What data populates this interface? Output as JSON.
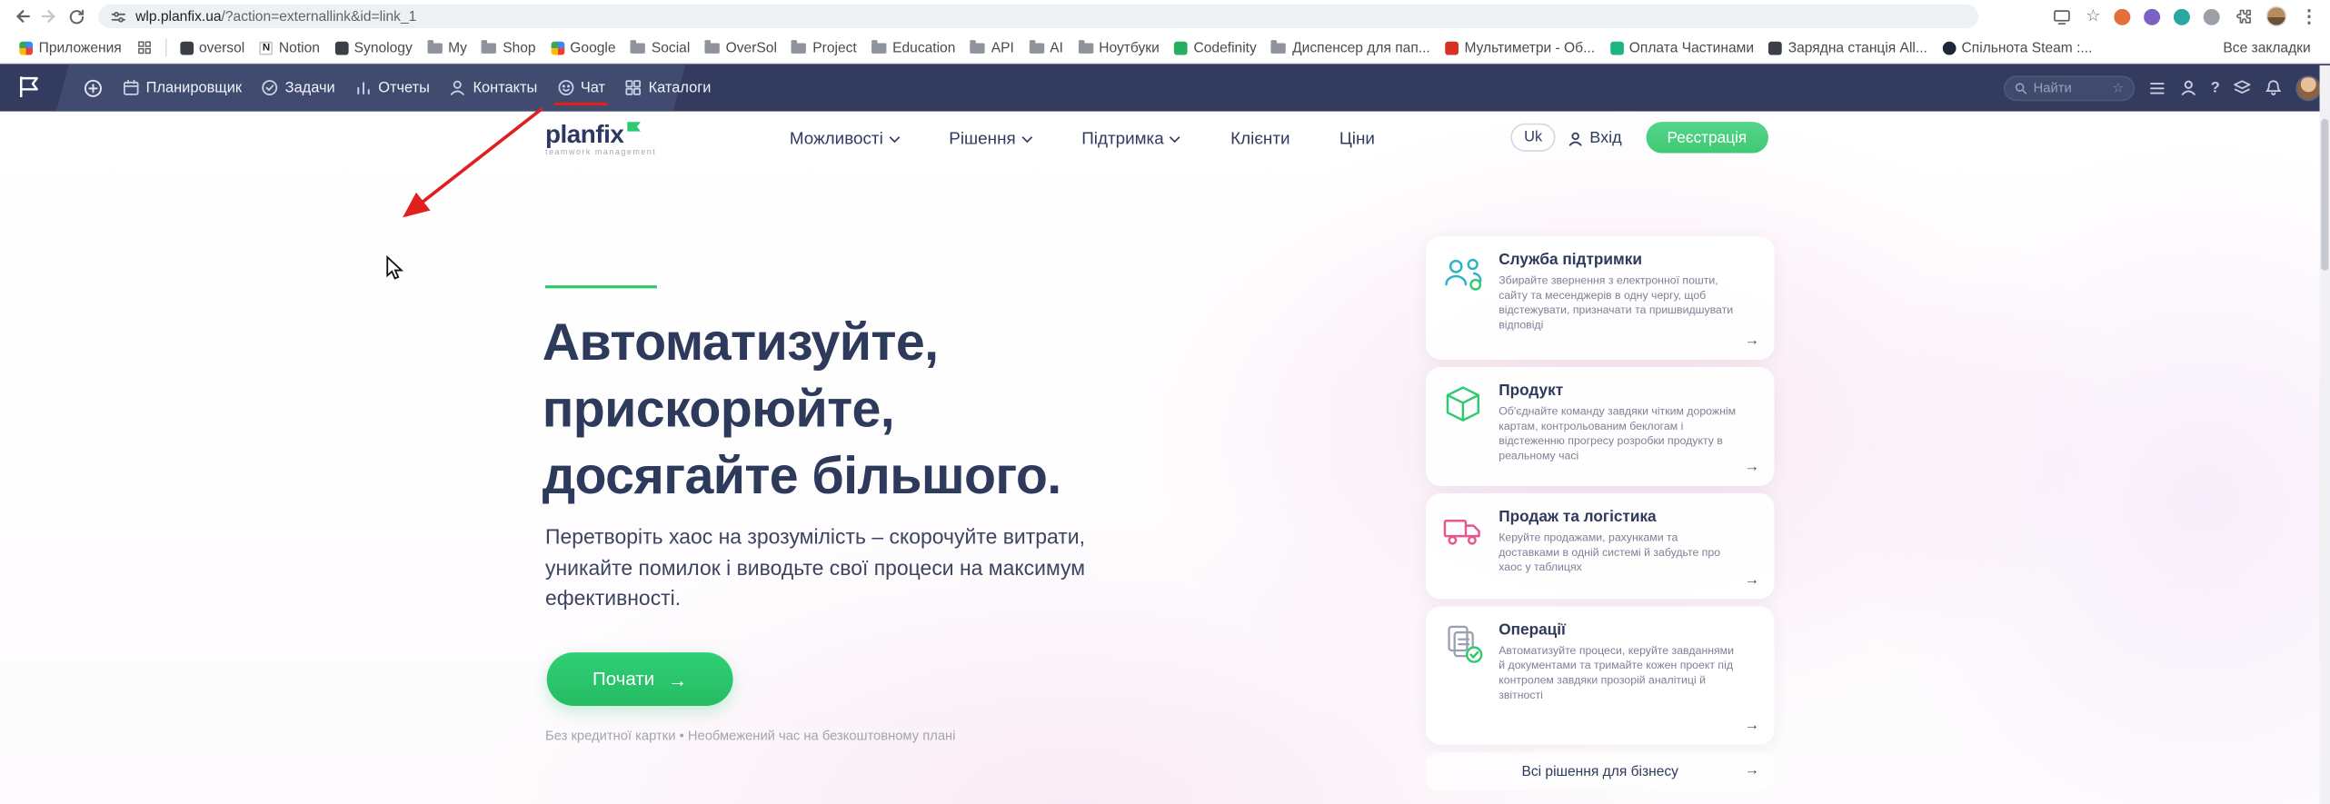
{
  "icons": {
    "arrow_right": "→",
    "dots_menu": "⋮",
    "star": "☆",
    "question": "?",
    "notion_glyph": "N"
  },
  "browser": {
    "url_domain": "wlp.planfix.ua",
    "url_path": "/?action=externallink&id=link_1",
    "bookmarks": [
      {
        "label": "Приложения",
        "icon": "apps-grid"
      },
      {
        "label": "oversol",
        "icon": "site-dark"
      },
      {
        "label": "Notion",
        "icon": "notion"
      },
      {
        "label": "Synology",
        "icon": "site-dark"
      },
      {
        "label": "My",
        "icon": "folder"
      },
      {
        "label": "Shop",
        "icon": "folder"
      },
      {
        "label": "Google",
        "icon": "google-grid"
      },
      {
        "label": "Social",
        "icon": "folder"
      },
      {
        "label": "OverSol",
        "icon": "folder"
      },
      {
        "label": "Project",
        "icon": "folder"
      },
      {
        "label": "Education",
        "icon": "folder"
      },
      {
        "label": "API",
        "icon": "folder"
      },
      {
        "label": "AI",
        "icon": "folder"
      },
      {
        "label": "Ноутбуки",
        "icon": "folder"
      },
      {
        "label": "Codefinity",
        "icon": "site-green"
      },
      {
        "label": "Диспенсер для пап...",
        "icon": "folder"
      },
      {
        "label": "Мультиметри - Об...",
        "icon": "site-red"
      },
      {
        "label": "Оплата Частинами",
        "icon": "site-teal"
      },
      {
        "label": "Зарядна станція All...",
        "icon": "site-dark"
      },
      {
        "label": "Спільнота Steam :...",
        "icon": "steam"
      }
    ],
    "all_bookmarks_label": "Все закладки"
  },
  "planfix_bar": {
    "nav": [
      {
        "label": "Планировщик",
        "icon": "planner-icon"
      },
      {
        "label": "Задачи",
        "icon": "tasks-icon"
      },
      {
        "label": "Отчеты",
        "icon": "reports-icon"
      },
      {
        "label": "Контакты",
        "icon": "contacts-icon"
      },
      {
        "label": "Чат",
        "icon": "chat-icon"
      },
      {
        "label": "Каталоги",
        "icon": "catalogs-icon"
      }
    ],
    "search_placeholder": "Найти"
  },
  "site": {
    "logo_text": "planfix",
    "logo_tagline": "teamwork management",
    "nav": [
      {
        "label": "Можливості",
        "has_dropdown": true
      },
      {
        "label": "Рішення",
        "has_dropdown": true
      },
      {
        "label": "Підтримка",
        "has_dropdown": true
      },
      {
        "label": "Клієнти",
        "has_dropdown": false
      },
      {
        "label": "Ціни",
        "has_dropdown": false
      }
    ],
    "lang_label": "Uk",
    "login_label": "Вхід",
    "signup_label": "Реєстрація",
    "hero": {
      "title_line1": "Автоматизуйте,",
      "title_line2": "прискорюйте,",
      "title_line3": "досягайте більшого.",
      "subtitle": "Перетворіть хаос на зрозумілість – скорочуйте витрати, уникайте помилок і виводьте свої процеси на максимум ефективності.",
      "cta_label": "Почати",
      "note": "Без кредитної картки • Необмежений час на безкоштовному плані"
    },
    "cards": [
      {
        "title": "Служба підтримки",
        "icon": "support-icon",
        "text": "Збирайте звернення з електронної пошти, сайту та месенджерів в одну чергу, щоб відстежувати, призначати та пришвидшувати відповіді"
      },
      {
        "title": "Продукт",
        "icon": "product-icon",
        "text": "Об'єднайте команду завдяки чітким дорожнім картам, контрольованим беклогам і відстеженню прогресу розробки продукту в реальному часі"
      },
      {
        "title": "Продаж та логістика",
        "icon": "sales-icon",
        "text": "Керуйте продажами, рахунками та доставками в одній системі й забудьте про хаос у таблицях"
      },
      {
        "title": "Операції",
        "icon": "operations-icon",
        "text": "Автоматизуйте процеси, керуйте завданнями й документами та тримайте кожен проект під контролем завдяки прозорій аналітиці й звітності"
      }
    ],
    "all_solutions_label": "Всі рішення для бізнесу"
  },
  "colors": {
    "accent_green": "#2eca72",
    "navy": "#2e3a5c",
    "topbar": "#333c5f",
    "annotation_red": "#e01f1f"
  }
}
